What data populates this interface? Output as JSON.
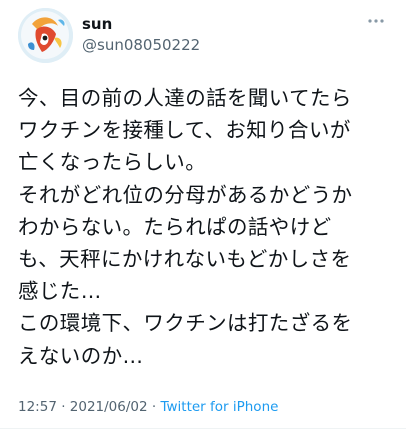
{
  "user": {
    "display_name": "sun",
    "handle": "@sun08050222",
    "avatar": "avatar-illustration"
  },
  "tweet": {
    "lines": [
      "今、目の前の人達の話を聞いてたら",
      "ワクチンを接種して、お知り合いが",
      "亡くなったらしい。",
      "それがどれ位の分母があるかどうか",
      "わからない。たられぱの話やけど",
      "も、天秤にかけれないもどかしさを",
      "感じた…",
      "この環境下、ワクチンは打たざるを",
      "えないのか…"
    ]
  },
  "meta": {
    "time": "12:57",
    "separator1": " · ",
    "date": "2021/06/02",
    "separator2": " · ",
    "source": "Twitter for iPhone"
  },
  "icons": {
    "more": "more-horizontal-icon"
  },
  "colors": {
    "text": "#0f1419",
    "secondary": "#536471",
    "link": "#1d9bf0"
  }
}
